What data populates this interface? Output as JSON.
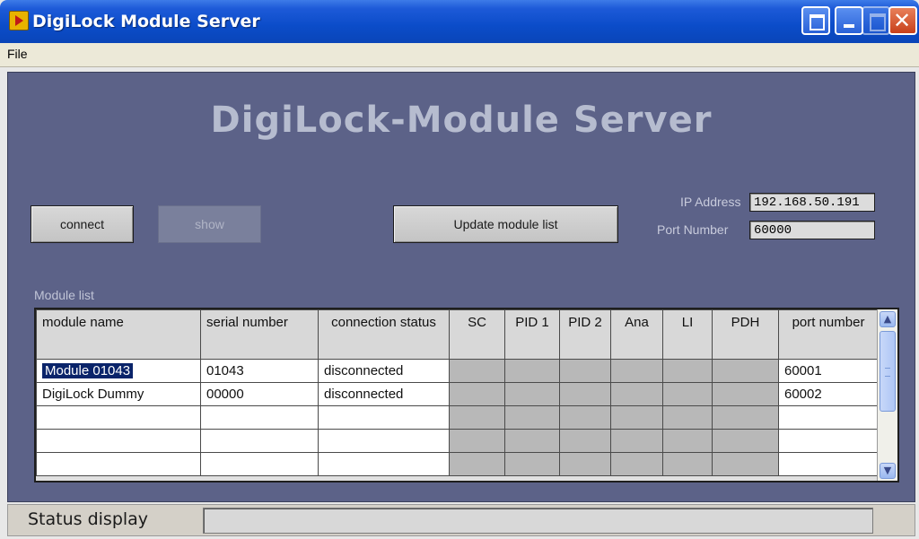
{
  "window": {
    "title": "DigiLock Module Server"
  },
  "menu": {
    "file": "File"
  },
  "heading": "DigiLock-Module Server",
  "buttons": {
    "connect": "connect",
    "show": "show",
    "update": "Update module list"
  },
  "ip_address": {
    "label": "IP Address",
    "value": "192.168.50.191"
  },
  "port_number": {
    "label": "Port Number",
    "value": "60000"
  },
  "module_list": {
    "label": "Module list",
    "columns": [
      "module name",
      "serial number",
      "connection status",
      "SC",
      "PID 1",
      "PID 2",
      "Ana",
      "LI",
      "PDH",
      "port number"
    ],
    "rows": [
      {
        "name": "Module 01043",
        "serial": "01043",
        "status": "disconnected",
        "port": "60001"
      },
      {
        "name": "DigiLock Dummy",
        "serial": "00000",
        "status": "disconnected",
        "port": "60002"
      }
    ]
  },
  "status": {
    "label": "Status display",
    "value": ""
  }
}
